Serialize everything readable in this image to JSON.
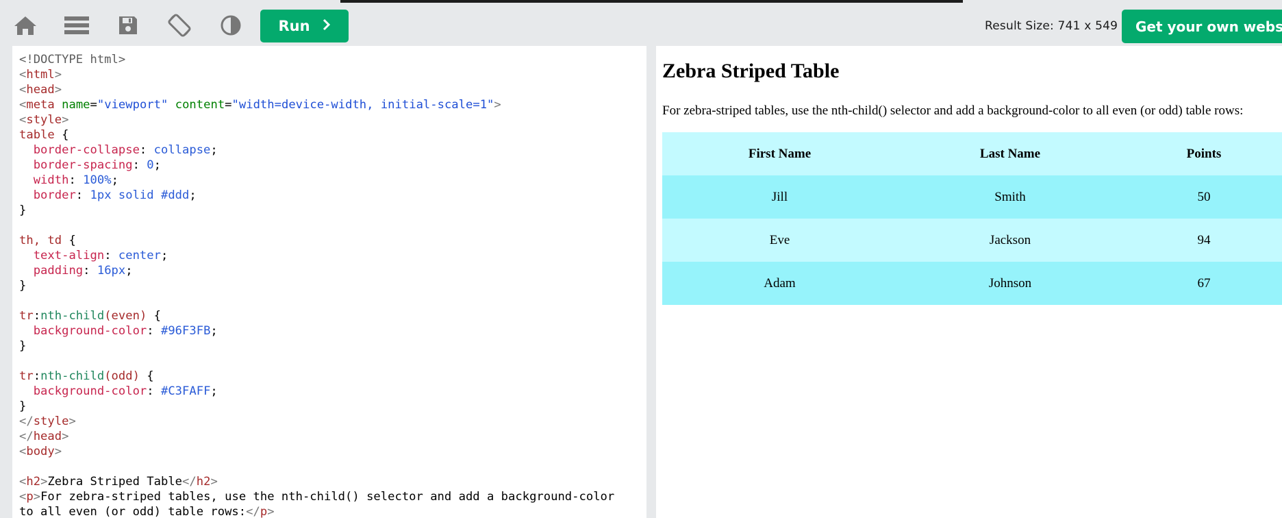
{
  "toolbar": {
    "icons": [
      "home-icon",
      "menu-icon",
      "save-icon",
      "rotate-icon",
      "contrast-icon"
    ],
    "run_label": "Run",
    "run_icon": "chevron-right-icon",
    "result_size": "Result Size: 741 x 549",
    "get_website_label": "Get your own website",
    "accent_color": "#04aa6d"
  },
  "editor": {
    "code_lines": [
      "<!DOCTYPE html>",
      "<html>",
      "<head>",
      "<meta name=\"viewport\" content=\"width=device-width, initial-scale=1\">",
      "<style>",
      "table {",
      "  border-collapse: collapse;",
      "  border-spacing: 0;",
      "  width: 100%;",
      "  border: 1px solid #ddd;",
      "}",
      "",
      "th, td {",
      "  text-align: center;",
      "  padding: 16px;",
      "}",
      "",
      "tr:nth-child(even) {",
      "  background-color: #96F3FB;",
      "}",
      "",
      "tr:nth-child(odd) {",
      "  background-color: #C3FAFF;",
      "}",
      "</style>",
      "</head>",
      "<body>",
      "",
      "<h2>Zebra Striped Table</h2>",
      "<p>For zebra-striped tables, use the nth-child() selector and add a background-color",
      "to all even (or odd) table rows:</p>"
    ]
  },
  "result": {
    "title": "Zebra Striped Table",
    "description": "For zebra-striped tables, use the nth-child() selector and add a background-color to all even (or odd) table rows:",
    "table": {
      "headers": [
        "First Name",
        "Last Name",
        "Points",
        ""
      ],
      "rows": [
        [
          "Jill",
          "Smith",
          "50",
          ""
        ],
        [
          "Eve",
          "Jackson",
          "94",
          ""
        ],
        [
          "Adam",
          "Johnson",
          "67",
          ""
        ]
      ],
      "even_color": "#96F3FB",
      "odd_color": "#C3FAFF"
    }
  }
}
